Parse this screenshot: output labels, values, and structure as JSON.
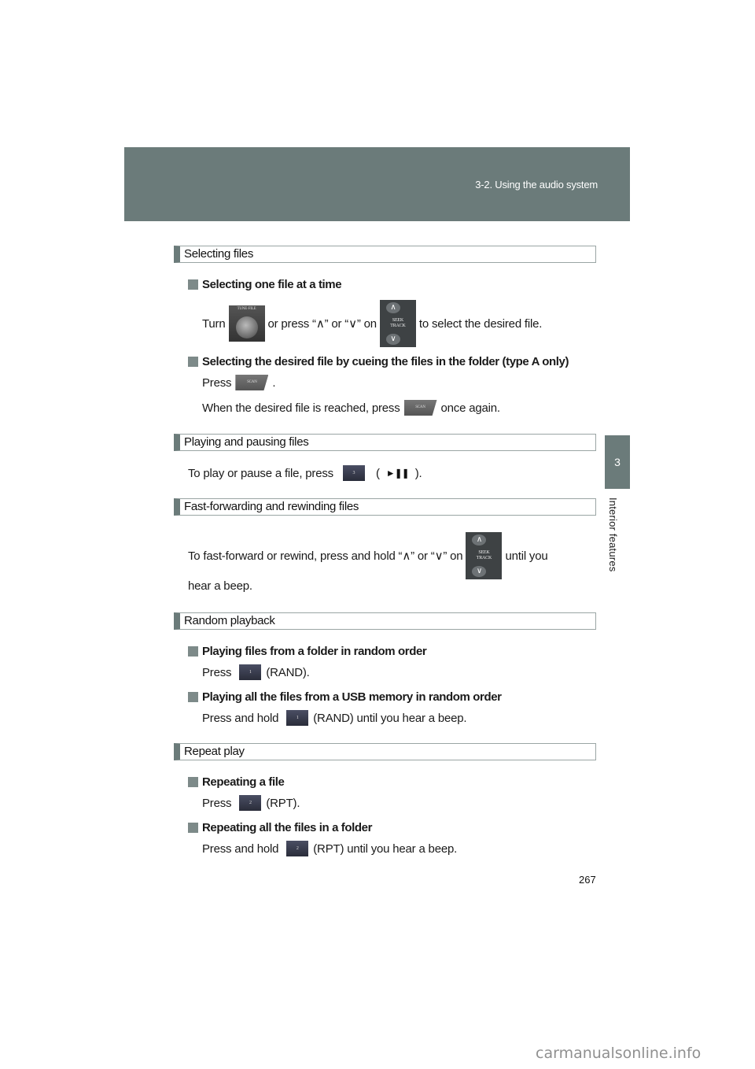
{
  "header": {
    "chapter_title": "3-2. Using the audio system"
  },
  "side_tab": {
    "number": "3",
    "label": "Interior features"
  },
  "icons": {
    "tune_file_knob": "TUNE·FILE",
    "seek_track": "SEEK\nTRACK",
    "scan": "SCAN",
    "preset_1": "1",
    "preset_2": "2",
    "preset_3": "3",
    "play_pause": "►❚❚",
    "up": "∧",
    "down": "∨"
  },
  "sections": {
    "selecting": {
      "title": "Selecting files",
      "sub1": "Selecting one file at a time",
      "sub1_a": "Turn",
      "sub1_b": "or press “∧” or “∨” on",
      "sub1_c": "to select the desired file.",
      "sub2": "Selecting the desired file by cueing the files in the folder (type A only)",
      "sub2_press": "Press",
      "sub2_period": ".",
      "sub2_when": "When the desired file is reached, press",
      "sub2_again": "once again."
    },
    "playing": {
      "title": "Playing and pausing files",
      "text_a": "To play or pause a file, press",
      "paren_open": "(",
      "paren_close": ")."
    },
    "ff": {
      "title": "Fast-forwarding and rewinding files",
      "text_a": "To fast-forward or rewind, press and hold “∧” or “∨” on",
      "text_b": "until you",
      "text_c": "hear a beep."
    },
    "random": {
      "title": "Random playback",
      "sub1": "Playing files from a folder in random order",
      "sub1_press": "Press",
      "sub1_tail": "(RAND).",
      "sub2": "Playing all the files from a USB memory in random order",
      "sub2_press": "Press and hold",
      "sub2_tail": "(RAND) until you hear a beep."
    },
    "repeat": {
      "title": "Repeat play",
      "sub1": "Repeating a file",
      "sub1_press": "Press",
      "sub1_tail": "(RPT).",
      "sub2": "Repeating all the files in a folder",
      "sub2_press": "Press and hold",
      "sub2_tail": "(RPT) until you hear a beep."
    }
  },
  "page_number": "267",
  "watermark": "carmanualsonline.info",
  "colors": {
    "accent": "#6b7b7a",
    "bullet": "#7d8a89"
  }
}
